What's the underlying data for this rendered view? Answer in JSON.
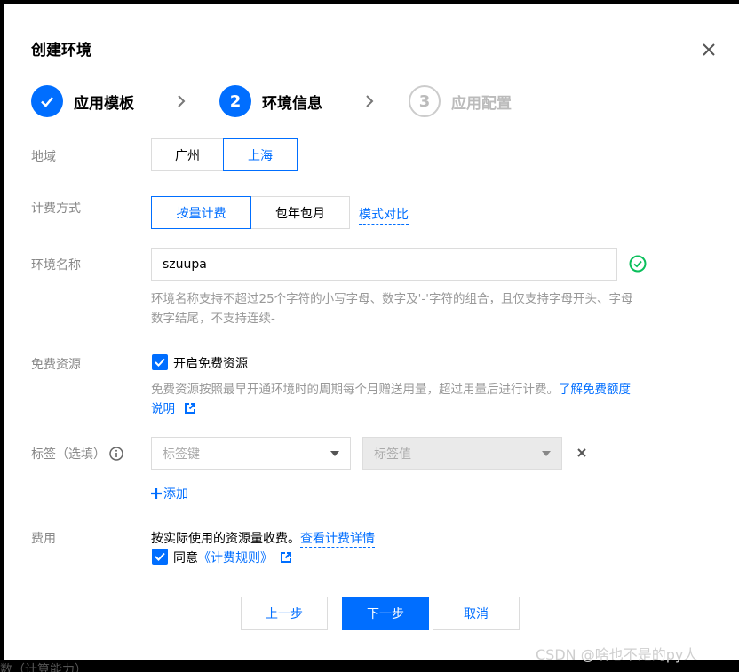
{
  "modal": {
    "title": "创建环境"
  },
  "steps": [
    {
      "label": "应用模板",
      "state": "done",
      "number": ""
    },
    {
      "label": "环境信息",
      "state": "active",
      "number": "2"
    },
    {
      "label": "应用配置",
      "state": "todo",
      "number": "3"
    }
  ],
  "region": {
    "label": "地域",
    "options": [
      "广州",
      "上海"
    ],
    "selected": "上海"
  },
  "billing": {
    "label": "计费方式",
    "options": [
      "按量计费",
      "包年包月"
    ],
    "selected": "按量计费",
    "compare_link": "模式对比"
  },
  "env_name": {
    "label": "环境名称",
    "value": "szuupa",
    "help_line1": "环境名称支持不超过25个字符的小写字母、数字及'-'字符的组合，且仅支持字母开头、字母",
    "help_line2": "数字结尾，不支持连续-"
  },
  "free_resource": {
    "label": "免费资源",
    "checkbox_label": "开启免费资源",
    "help_text": "免费资源按照最早开通环境时的周期每个月赠送用量，超过用量后进行计费。",
    "link_part1": "了解免费额度",
    "link_part2": "说明"
  },
  "tags": {
    "label": "标签（选填）",
    "key_placeholder": "标签键",
    "value_placeholder": "标签值",
    "add_label": "添加"
  },
  "fee": {
    "label": "费用",
    "text": "按实际使用的资源量收费。",
    "detail_link": "查看计费详情",
    "agree_text": "同意",
    "rules_link": "《计费规则》"
  },
  "footer": {
    "prev": "上一步",
    "next": "下一步",
    "cancel": "取消"
  },
  "watermark": "CSDN @啥也不是的py人",
  "background_text": "数（计算能力）",
  "colors": {
    "primary": "#006eff",
    "success": "#0abf5b"
  }
}
